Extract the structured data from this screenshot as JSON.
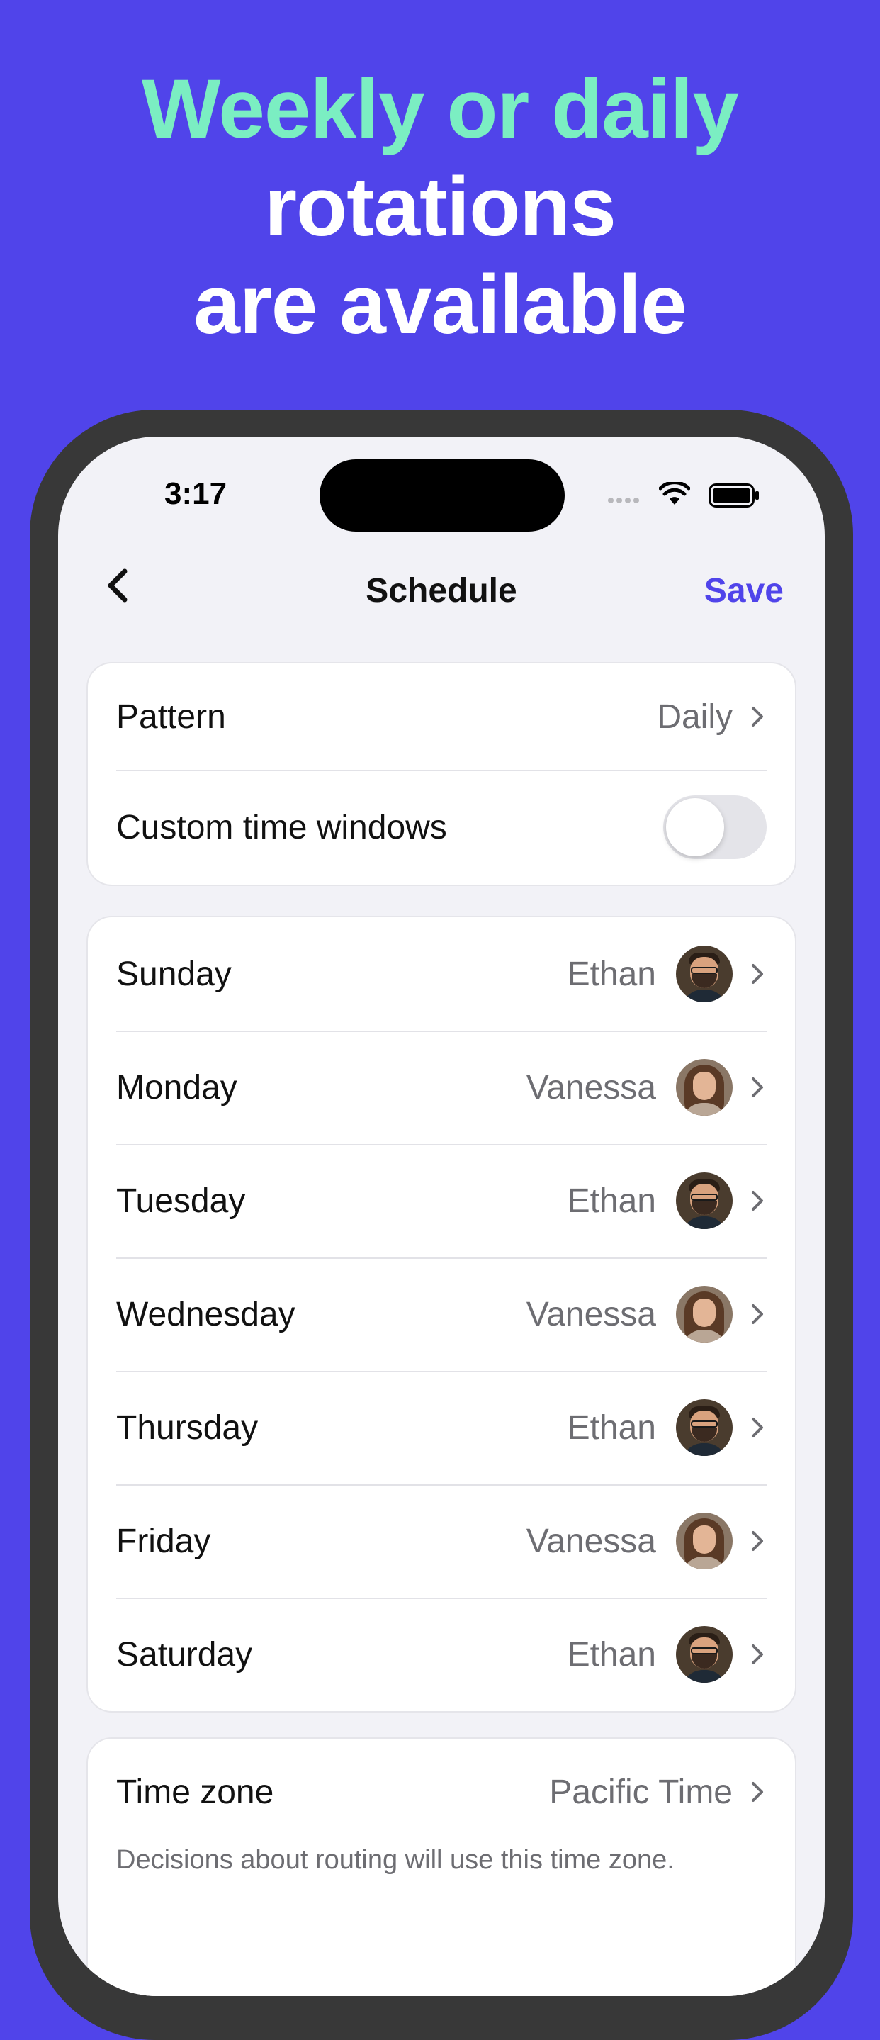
{
  "headline": {
    "line1": "Weekly or daily",
    "line2": "rotations",
    "line3": "are available"
  },
  "status_bar": {
    "time": "3:17"
  },
  "nav": {
    "title": "Schedule",
    "save_label": "Save"
  },
  "settings": {
    "pattern_label": "Pattern",
    "pattern_value": "Daily",
    "custom_windows_label": "Custom time windows",
    "custom_windows_enabled": false
  },
  "days": [
    {
      "day": "Sunday",
      "person": "Ethan"
    },
    {
      "day": "Monday",
      "person": "Vanessa"
    },
    {
      "day": "Tuesday",
      "person": "Ethan"
    },
    {
      "day": "Wednesday",
      "person": "Vanessa"
    },
    {
      "day": "Thursday",
      "person": "Ethan"
    },
    {
      "day": "Friday",
      "person": "Vanessa"
    },
    {
      "day": "Saturday",
      "person": "Ethan"
    }
  ],
  "timezone": {
    "label": "Time zone",
    "value": "Pacific Time",
    "note": "Decisions about routing will use this time zone."
  },
  "colors": {
    "background": "#5044EA",
    "headline_accent": "#7BEEC2",
    "accent": "#5044EA"
  }
}
